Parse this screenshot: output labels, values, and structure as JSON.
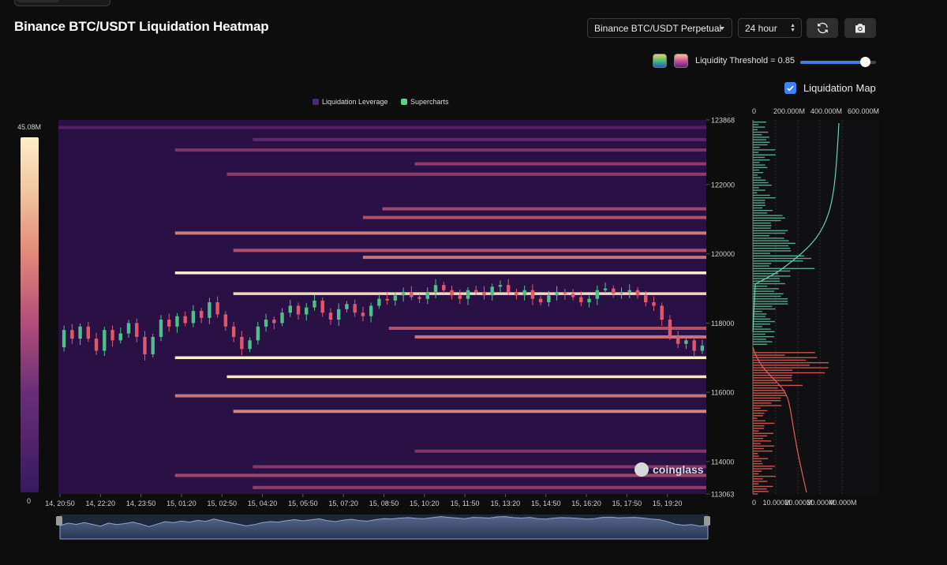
{
  "header": {
    "title": "Binance BTC/USDT Liquidation Heatmap",
    "pair_select": "Binance BTC/USDT Perpetual",
    "range_select": "24 hour",
    "refresh_icon": "refresh-icon",
    "camera_icon": "camera-icon"
  },
  "controls": {
    "threshold_label": "Liquidity Threshold = 0.85",
    "threshold_value": 0.85,
    "liq_map_label": "Liquidation Map",
    "liq_map_checked": true,
    "swatch_1_colors": [
      "#f0d060",
      "#46c07a",
      "#2b5bb5"
    ],
    "swatch_2_colors": [
      "#f6c4a0",
      "#d0508c",
      "#5a2380"
    ]
  },
  "legend": {
    "items": [
      {
        "label": "Liquidation Leverage",
        "color": "#4b2a78"
      },
      {
        "label": "Supercharts",
        "color": "#5fd08a"
      }
    ]
  },
  "colorbar": {
    "max_label": "45.08M",
    "min_label": "0"
  },
  "watermark": "coinglass",
  "chart_data": {
    "type": "heatmap",
    "title": "Binance BTC/USDT Liquidation Heatmap",
    "y_range": [
      113063,
      123868
    ],
    "y_ticks": [
      {
        "value": 123868,
        "label": "123868"
      },
      {
        "value": 122000,
        "label": "122000"
      },
      {
        "value": 120000,
        "label": "120000"
      },
      {
        "value": 118000,
        "label": "118000"
      },
      {
        "value": 116000,
        "label": "116000"
      },
      {
        "value": 114000,
        "label": "114000"
      },
      {
        "value": 113063,
        "label": "113063"
      }
    ],
    "x_ticks": [
      "14, 20:50",
      "14, 22:20",
      "14, 23:50",
      "15, 01:20",
      "15, 02:50",
      "15, 04:20",
      "15, 05:50",
      "15, 07:20",
      "15, 08:50",
      "15, 10:20",
      "15, 11:50",
      "15, 13:20",
      "15, 14:50",
      "15, 16:20",
      "15, 17:50",
      "15, 19:20"
    ],
    "liquidation_bands": [
      {
        "price": 123650,
        "start": 0.0,
        "intensity": 0.25
      },
      {
        "price": 123300,
        "start": 0.3,
        "intensity": 0.35
      },
      {
        "price": 123000,
        "start": 0.18,
        "intensity": 0.45
      },
      {
        "price": 122600,
        "start": 0.55,
        "intensity": 0.5
      },
      {
        "price": 122300,
        "start": 0.26,
        "intensity": 0.5
      },
      {
        "price": 121300,
        "start": 0.5,
        "intensity": 0.55
      },
      {
        "price": 121050,
        "start": 0.47,
        "intensity": 0.6
      },
      {
        "price": 120600,
        "start": 0.18,
        "intensity": 0.72
      },
      {
        "price": 120100,
        "start": 0.27,
        "intensity": 0.6
      },
      {
        "price": 119900,
        "start": 0.47,
        "intensity": 0.7
      },
      {
        "price": 119450,
        "start": 0.18,
        "intensity": 1.0
      },
      {
        "price": 118850,
        "start": 0.27,
        "intensity": 0.95
      },
      {
        "price": 117850,
        "start": 0.51,
        "intensity": 0.6
      },
      {
        "price": 117600,
        "start": 0.55,
        "intensity": 0.7
      },
      {
        "price": 117000,
        "start": 0.18,
        "intensity": 1.0
      },
      {
        "price": 116450,
        "start": 0.26,
        "intensity": 0.98
      },
      {
        "price": 115900,
        "start": 0.18,
        "intensity": 0.7
      },
      {
        "price": 115450,
        "start": 0.27,
        "intensity": 0.75
      },
      {
        "price": 114300,
        "start": 0.55,
        "intensity": 0.45
      },
      {
        "price": 113850,
        "start": 0.3,
        "intensity": 0.45
      },
      {
        "price": 113600,
        "start": 0.18,
        "intensity": 0.55
      },
      {
        "price": 113250,
        "start": 0.3,
        "intensity": 0.5
      }
    ],
    "price_series": [
      117300,
      117800,
      117550,
      117900,
      117550,
      117200,
      117800,
      117500,
      117700,
      118000,
      117600,
      117100,
      117600,
      118100,
      117900,
      118200,
      118000,
      118350,
      118150,
      118600,
      118250,
      117900,
      117600,
      117250,
      117500,
      117900,
      118100,
      118000,
      118300,
      118500,
      118250,
      118450,
      118650,
      118300,
      118100,
      118400,
      118550,
      118300,
      118200,
      118500,
      118700,
      118650,
      118800,
      118900,
      118750,
      118700,
      118900,
      119100,
      118950,
      118800,
      118700,
      118950,
      118900,
      118800,
      119050,
      119100,
      118900,
      118800,
      118950,
      118700,
      118600,
      118800,
      118900,
      118850,
      118750,
      118600,
      118700,
      118950,
      119000,
      118850,
      118900,
      118950,
      118800,
      118600,
      118500,
      118100,
      117600,
      117400,
      117500,
      117200,
      117350
    ]
  },
  "liquidation_map": {
    "top_axis": [
      "0",
      "200.000M",
      "400.000M",
      "600.000M"
    ],
    "bottom_axis": [
      "0",
      "10.000M",
      "20.000M",
      "30.000M",
      "40.000M"
    ]
  }
}
